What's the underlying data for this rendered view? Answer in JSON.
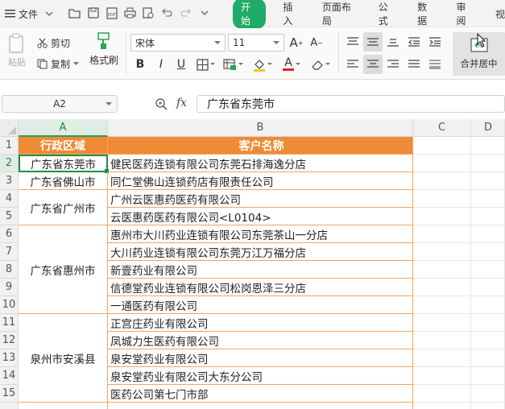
{
  "titlebar": {
    "file_menu": "文件",
    "menu_tabs": [
      "开始",
      "插入",
      "页面布局",
      "公式",
      "数据",
      "审阅",
      "视"
    ]
  },
  "ribbon": {
    "paste_label": "粘贴",
    "cut_label": "剪切",
    "copy_label": "复制",
    "format_painter_label": "格式刷",
    "font_name": "宋体",
    "font_size": "11",
    "merge_center_label": "合并居中",
    "bold": "B",
    "italic": "I",
    "underline": "U",
    "font_color_glyph": "A",
    "grow_font": "A",
    "shrink_font": "A"
  },
  "formula_bar": {
    "name_box": "A2",
    "fx_label": "fx",
    "content": "广东省东莞市"
  },
  "sheet": {
    "columns": [
      "A",
      "B",
      "C",
      "D"
    ],
    "rows": [
      "1",
      "2",
      "3",
      "4",
      "5",
      "6",
      "7",
      "8",
      "9",
      "10",
      "11",
      "12",
      "13",
      "14",
      "15"
    ],
    "header": {
      "a": "行政区域",
      "b": "客户名称"
    },
    "regions": [
      "广东省东莞市",
      "广东省佛山市",
      "广东省广州市",
      "广东省惠州市",
      "泉州市安溪县"
    ],
    "customers": [
      "健民医药连锁有限公司东莞石排海逸分店",
      "同仁堂佛山连锁药店有限责任公司",
      "广州云医惠药医药有限公司",
      "云医惠药医药有限公司<L0104>",
      "惠州市大川药业连锁有限公司东莞茶山一分店",
      "大川药业连锁有限公司东莞万江万福分店",
      "新壹药业有限公司",
      "信德堂药业连锁有限公司松岗恩泽三分店",
      "一通医药有限公司",
      "正宫庄药业有限公司",
      "凤城力生医药有限公司",
      "泉安堂药业有限公司",
      "泉安堂药业有限公司大东分公司",
      "医药公司第七门市部"
    ]
  }
}
